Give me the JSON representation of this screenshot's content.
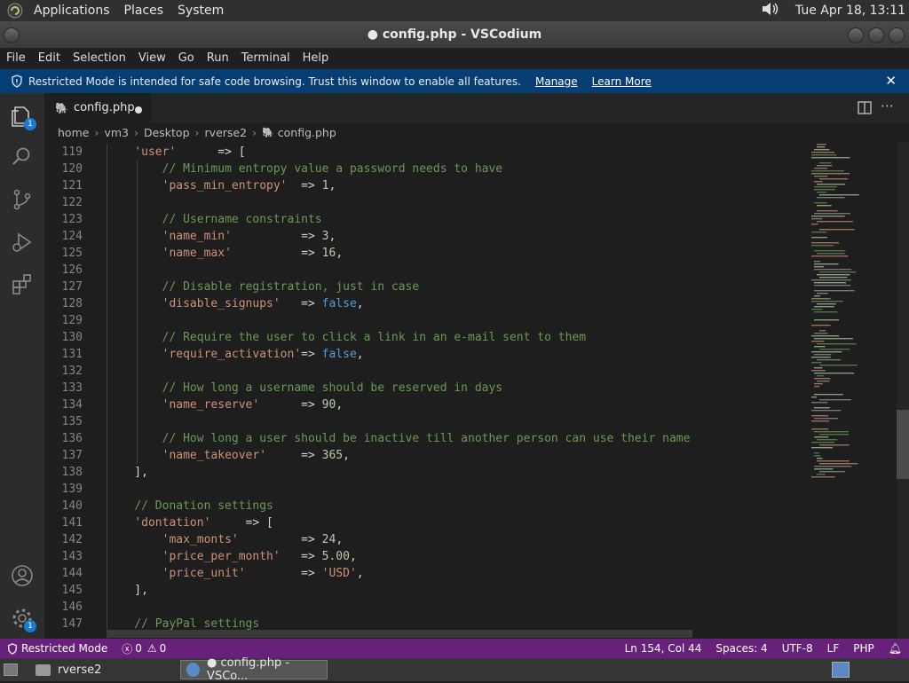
{
  "top_panel": {
    "menus": [
      "Applications",
      "Places",
      "System"
    ],
    "datetime": "Tue Apr 18, 13:11"
  },
  "window": {
    "title": "● config.php - VSCodium"
  },
  "menubar": [
    "File",
    "Edit",
    "Selection",
    "View",
    "Go",
    "Run",
    "Terminal",
    "Help"
  ],
  "banner": {
    "text": "Restricted Mode is intended for safe code browsing. Trust this window to enable all features.",
    "manage": "Manage",
    "learn_more": "Learn More"
  },
  "activity_badges": {
    "explorer": "1",
    "settings": "1"
  },
  "tab": {
    "label": "config.php"
  },
  "breadcrumb": [
    "home",
    "vm3",
    "Desktop",
    "rverse2",
    "config.php"
  ],
  "code_lines": [
    {
      "n": "119",
      "t": "    'user'      => ["
    },
    {
      "n": "120",
      "t": "        // Minimum entropy value a password needs to have"
    },
    {
      "n": "121",
      "t": "        'pass_min_entropy'  => 1,"
    },
    {
      "n": "122",
      "t": ""
    },
    {
      "n": "123",
      "t": "        // Username constraints"
    },
    {
      "n": "124",
      "t": "        'name_min'          => 3,"
    },
    {
      "n": "125",
      "t": "        'name_max'          => 16,"
    },
    {
      "n": "126",
      "t": ""
    },
    {
      "n": "127",
      "t": "        // Disable registration, just in case"
    },
    {
      "n": "128",
      "t": "        'disable_signups'   => false,"
    },
    {
      "n": "129",
      "t": ""
    },
    {
      "n": "130",
      "t": "        // Require the user to click a link in an e-mail sent to them"
    },
    {
      "n": "131",
      "t": "        'require_activation'=> false,"
    },
    {
      "n": "132",
      "t": ""
    },
    {
      "n": "133",
      "t": "        // How long a username should be reserved in days"
    },
    {
      "n": "134",
      "t": "        'name_reserve'      => 90,"
    },
    {
      "n": "135",
      "t": ""
    },
    {
      "n": "136",
      "t": "        // How long a user should be inactive till another person can use their name"
    },
    {
      "n": "137",
      "t": "        'name_takeover'     => 365,"
    },
    {
      "n": "138",
      "t": "    ],"
    },
    {
      "n": "139",
      "t": ""
    },
    {
      "n": "140",
      "t": "    // Donation settings"
    },
    {
      "n": "141",
      "t": "    'dontation'     => ["
    },
    {
      "n": "142",
      "t": "        'max_monts'         => 24,"
    },
    {
      "n": "143",
      "t": "        'price_per_month'   => 5.00,"
    },
    {
      "n": "144",
      "t": "        'price_unit'        => 'USD',"
    },
    {
      "n": "145",
      "t": "    ],"
    },
    {
      "n": "146",
      "t": ""
    },
    {
      "n": "147",
      "t": "    // PayPal settings"
    }
  ],
  "status": {
    "restricted": "Restricted Mode",
    "errors": "0",
    "warnings": "0",
    "position": "Ln 154, Col 44",
    "spaces": "Spaces: 4",
    "encoding": "UTF-8",
    "eol": "LF",
    "language": "PHP"
  },
  "taskbar": {
    "folder": "rverse2",
    "window": "● config.php - VSCo..."
  }
}
